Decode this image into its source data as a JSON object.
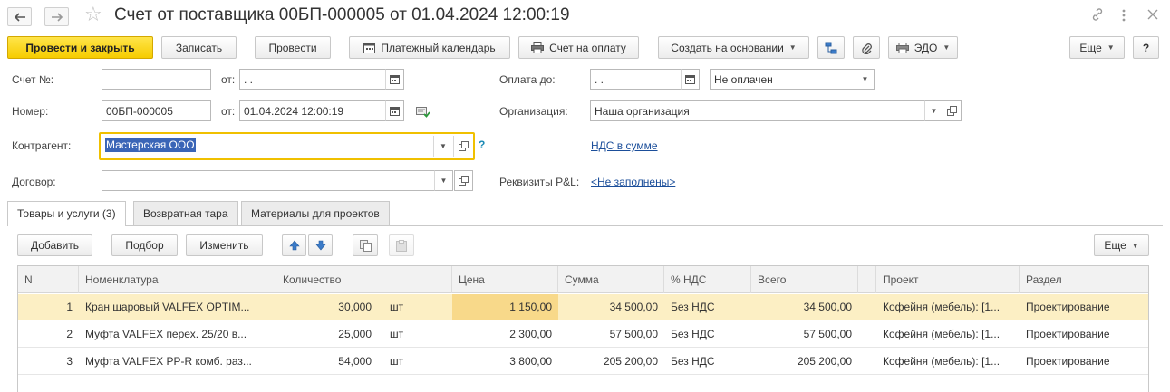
{
  "window": {
    "title": "Счет от поставщика 00БП-000005 от 01.04.2024 12:00:19"
  },
  "toolbar": {
    "post_close": "Провести и закрыть",
    "write": "Записать",
    "post": "Провести",
    "payment_calendar": "Платежный календарь",
    "invoice_payment": "Счет на оплату",
    "create_based": "Создать на основании",
    "edo": "ЭДО",
    "more": "Еще",
    "help": "?"
  },
  "form": {
    "invoice_no_label": "Счет №:",
    "invoice_no_value": "",
    "from_label": "от:",
    "invoice_date_value": " .  .",
    "number_label": "Номер:",
    "number_value": "00БП-000005",
    "date_value": "01.04.2024 12:00:19",
    "counterparty_label": "Контрагент:",
    "counterparty_value": "Мастерская ООО",
    "contract_label": "Договор:",
    "contract_value": "",
    "pay_until_label": "Оплата до:",
    "pay_until_value": " .  .",
    "payment_status": "Не оплачен",
    "organization_label": "Организация:",
    "organization_value": "Наша организация",
    "vat_link": "НДС в сумме",
    "pl_label": "Реквизиты P&L:",
    "pl_link": "<Не заполнены>",
    "help_mark": "?"
  },
  "tabs": [
    {
      "label": "Товары и услуги (3)"
    },
    {
      "label": "Возвратная тара"
    },
    {
      "label": "Материалы для проектов"
    }
  ],
  "table_toolbar": {
    "add": "Добавить",
    "pick": "Подбор",
    "change": "Изменить",
    "more": "Еще"
  },
  "table": {
    "columns": [
      "N",
      "Номенклатура",
      "Количество",
      "Цена",
      "Сумма",
      "% НДС",
      "Всего",
      "Проект",
      "Раздел"
    ],
    "rows": [
      {
        "n": "1",
        "item": "Кран шаровый VALFEX OPTIM...",
        "qty": "30,000",
        "unit": "шт",
        "price": "1 150,00",
        "sum": "34 500,00",
        "vat": "Без НДС",
        "total": "34 500,00",
        "project": "Кофейня (мебель): [1...",
        "section": "Проектирование"
      },
      {
        "n": "2",
        "item": "Муфта VALFEX перех. 25/20 в...",
        "qty": "25,000",
        "unit": "шт",
        "price": "2 300,00",
        "sum": "57 500,00",
        "vat": "Без НДС",
        "total": "57 500,00",
        "project": "Кофейня (мебель): [1...",
        "section": "Проектирование"
      },
      {
        "n": "3",
        "item": "Муфта VALFEX PP-R комб. раз...",
        "qty": "54,000",
        "unit": "шт",
        "price": "3 800,00",
        "sum": "205 200,00",
        "vat": "Без НДС",
        "total": "205 200,00",
        "project": "Кофейня (мебель): [1...",
        "section": "Проектирование"
      }
    ]
  },
  "colors": {
    "accent_yellow": "#f6cc00",
    "selected_row": "#fcefc4",
    "selected_cell": "#f8d98a",
    "link": "#1b4e9a",
    "focus_border": "#f0c000",
    "selection_text_bg": "#3a65b7"
  }
}
